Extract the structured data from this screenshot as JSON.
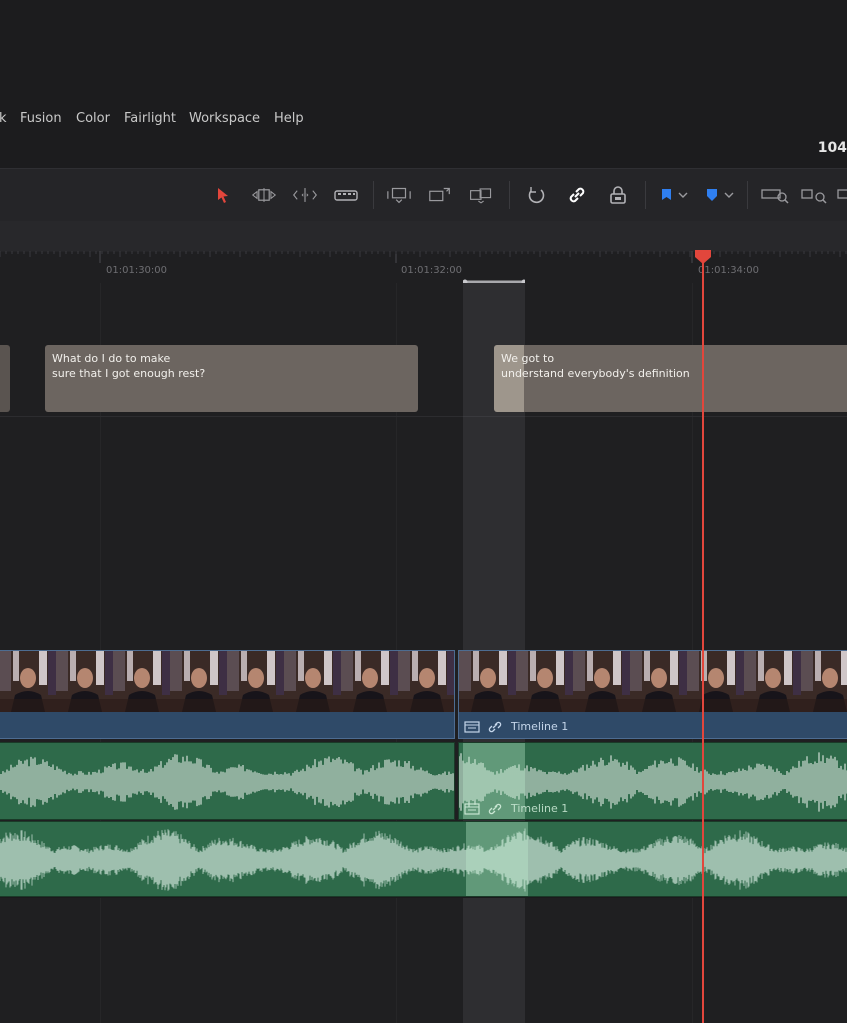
{
  "menubar": {
    "items": [
      {
        "label": "k"
      },
      {
        "label": "Fusion"
      },
      {
        "label": "Color"
      },
      {
        "label": "Fairlight"
      },
      {
        "label": "Workspace"
      },
      {
        "label": "Help"
      }
    ]
  },
  "status": {
    "timecode_partial": "104"
  },
  "toolbar": {
    "tools": [
      "selection-tool-icon",
      "trim-tool-icon",
      "dynamic-trim-icon",
      "blade-tool-icon",
      "insert-clip-icon",
      "overwrite-clip-icon",
      "replace-clip-icon",
      "snapping-icon",
      "linked-selection-icon",
      "position-lock-icon",
      "flag-icon",
      "marker-icon",
      "zoom-full-icon",
      "zoom-detail-icon"
    ],
    "accent_red": "#e2463c",
    "accent_blue": "#2f7ff0"
  },
  "ruler": {
    "labels": [
      "01:01:30:00",
      "01:01:32:00",
      "01:01:34:00"
    ]
  },
  "subtitles": {
    "clip1": {
      "line1": "What do I do to make",
      "line2": "sure that I got enough rest?"
    },
    "clip2": {
      "line1": "We got to",
      "line2": "understand everybody's definition"
    }
  },
  "video_track": {
    "clip2_label": "Timeline 1"
  },
  "audio_track": {
    "clip2_label": "Timeline 1"
  },
  "colors": {
    "video_clip": "#2f4a68",
    "audio_clip": "#2e6a4a",
    "subtitle_clip": "#6c6560",
    "playhead": "#e2463c"
  }
}
